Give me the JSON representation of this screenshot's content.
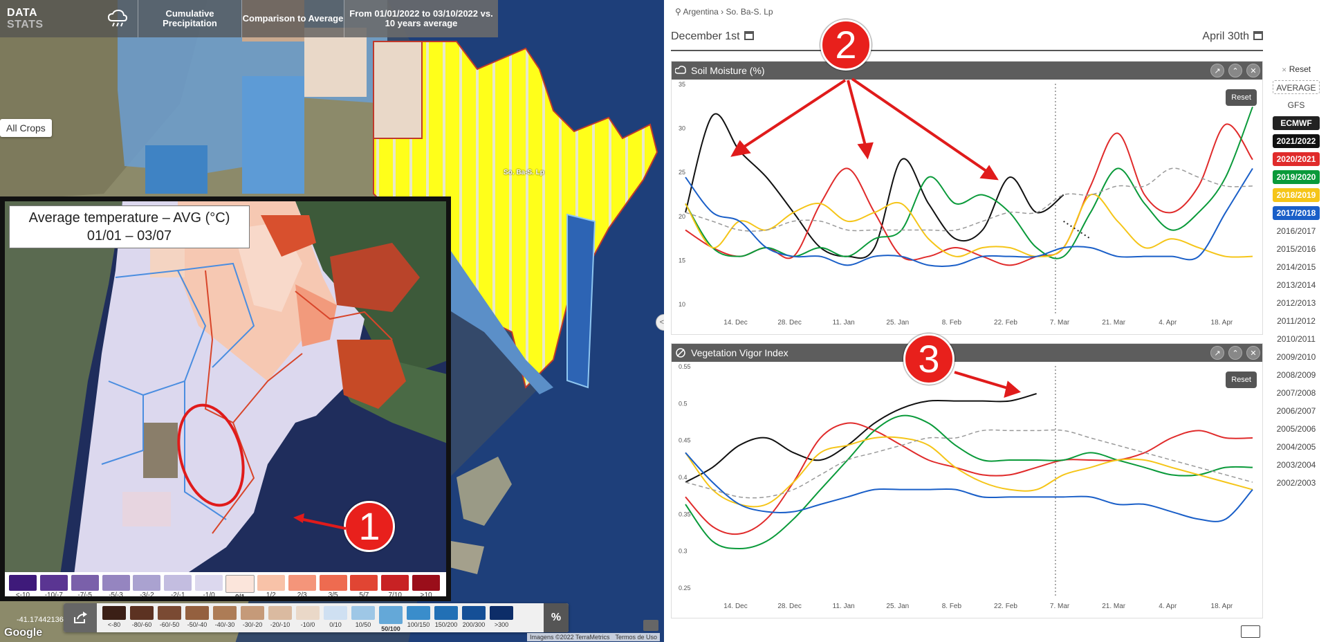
{
  "map": {
    "logo_line1": "DATA",
    "logo_line2": "STATS",
    "weather_icon": "cloud-rain-icon",
    "seg1": "Cumulative Precipitation",
    "seg2": "Comparison to Average",
    "seg3": "From 01/01/2022 to 03/10/2022 vs. 10 years average",
    "all_crops": "All Crops",
    "region_label": "So. Ba-S. Lp",
    "inset_title_line1": "Average temperature – AVG (°C)",
    "inset_title_line2": "01/01 – 03/07",
    "temp_legend": [
      {
        "label": "<-10",
        "color": "#3e1a7a"
      },
      {
        "label": "-10/-7",
        "color": "#5a3592"
      },
      {
        "label": "-7/-5",
        "color": "#7a60aa"
      },
      {
        "label": "-5/-3",
        "color": "#9585c0"
      },
      {
        "label": "-3/-2",
        "color": "#aaa2d0"
      },
      {
        "label": "-2/-1",
        "color": "#c3bde0"
      },
      {
        "label": "-1/0",
        "color": "#dcd8ee"
      },
      {
        "label": "0/1",
        "color": "#fbe5db",
        "selected": true
      },
      {
        "label": "1/2",
        "color": "#f8c2a8"
      },
      {
        "label": "2/3",
        "color": "#f4957a"
      },
      {
        "label": "3/5",
        "color": "#ee6b50"
      },
      {
        "label": "5/7",
        "color": "#e14533"
      },
      {
        "label": "7/10",
        "color": "#c82224"
      },
      {
        "label": ">10",
        "color": "#9a0e1a"
      }
    ],
    "precip_legend": [
      {
        "label": "<-80",
        "color": "#3b1f16"
      },
      {
        "label": "-80/-60",
        "color": "#5c3222"
      },
      {
        "label": "-60/-50",
        "color": "#7a4a33"
      },
      {
        "label": "-50/-40",
        "color": "#94603f"
      },
      {
        "label": "-40/-30",
        "color": "#ad7c56"
      },
      {
        "label": "-30/-20",
        "color": "#c59a79"
      },
      {
        "label": "-20/-10",
        "color": "#dabaa0"
      },
      {
        "label": "-10/0",
        "color": "#ead8c8"
      },
      {
        "label": "0/10",
        "color": "#cfe0f2"
      },
      {
        "label": "10/50",
        "color": "#9ec7e6"
      },
      {
        "label": "50/100",
        "color": "#64a8d8",
        "selected": true
      },
      {
        "label": "100/150",
        "color": "#3a8dcb"
      },
      {
        "label": "150/200",
        "color": "#2270b5"
      },
      {
        "label": "200/300",
        "color": "#154f96"
      },
      {
        ">300": "",
        "label": ">300",
        "color": "#0d2d68"
      }
    ],
    "pct_label": "%",
    "coords": "-41.17442136",
    "google": "Google",
    "attribution": "Imagens ©2022 TerraMetrics",
    "terms": "Termos de Uso"
  },
  "annotations": {
    "c1": "1",
    "c2": "2",
    "c3": "3"
  },
  "panel": {
    "breadcrumb": "Argentina › So. Ba-S. Lp",
    "date_start": "December 1st",
    "date_end": "April 30th",
    "reset_label": "Reset",
    "years": [
      {
        "label": "AVERAGE",
        "kind": "avg"
      },
      {
        "label": "GFS"
      },
      {
        "label": "ECMWF",
        "color": "#222222",
        "active": true
      },
      {
        "label": "2021/2022",
        "color": "#111111",
        "active": true
      },
      {
        "label": "2020/2021",
        "color": "#e02b2b",
        "active": true
      },
      {
        "label": "2019/2020",
        "color": "#0a9a3a",
        "active": true
      },
      {
        "label": "2018/2019",
        "color": "#f5c518",
        "active": true
      },
      {
        "label": "2017/2018",
        "color": "#1a5fc8",
        "active": true
      },
      {
        "label": "2016/2017"
      },
      {
        "label": "2015/2016"
      },
      {
        "label": "2014/2015"
      },
      {
        "label": "2013/2014"
      },
      {
        "label": "2012/2013"
      },
      {
        "label": "2011/2012"
      },
      {
        "label": "2010/2011"
      },
      {
        "label": "2009/2010"
      },
      {
        "label": "2008/2009"
      },
      {
        "label": "2007/2008"
      },
      {
        "label": "2006/2007"
      },
      {
        "label": "2005/2006"
      },
      {
        "label": "2004/2005"
      },
      {
        "label": "2003/2004"
      },
      {
        "label": "2002/2003"
      }
    ]
  },
  "chart_data": [
    {
      "type": "line",
      "title": "Soil Moisture (%)",
      "x": [
        "1 Dec",
        "8 Dec",
        "15 Dec",
        "22 Dec",
        "29 Dec",
        "5 Jan",
        "12 Jan",
        "19 Jan",
        "26 Jan",
        "2 Feb",
        "9 Feb",
        "16 Feb",
        "23 Feb",
        "2 Mar",
        "9 Mar",
        "16 Mar",
        "23 Mar",
        "30 Mar",
        "6 Apr",
        "13 Apr",
        "20 Apr",
        "27 Apr"
      ],
      "x_tick_labels": [
        "14. Dec",
        "28. Dec",
        "11. Jan",
        "25. Jan",
        "8. Feb",
        "22. Feb",
        "7. Mar",
        "21. Mar",
        "4. Apr",
        "18. Apr"
      ],
      "ylim": [
        10,
        35
      ],
      "y_ticks": [
        10,
        15,
        20,
        25,
        30,
        35
      ],
      "today_marker": "9 Mar",
      "series": [
        {
          "name": "2021/2022",
          "color": "#111111",
          "values": [
            21,
            32,
            28,
            25,
            21,
            17,
            16,
            17,
            27,
            22,
            18,
            19,
            25,
            21,
            23,
            null,
            null,
            null,
            null,
            null,
            null,
            null
          ]
        },
        {
          "name": "2020/2021",
          "color": "#e02b2b",
          "values": [
            19,
            17,
            16,
            17,
            16,
            22,
            26,
            21,
            16,
            16,
            17,
            16,
            15,
            16,
            17,
            24,
            30,
            23,
            21,
            24,
            31,
            27
          ]
        },
        {
          "name": "2019/2020",
          "color": "#0a9a3a",
          "values": [
            22,
            17,
            16,
            17,
            16,
            17,
            16,
            18,
            19,
            25,
            22,
            23,
            21,
            17,
            16,
            21,
            26,
            22,
            19,
            21,
            25,
            33
          ]
        },
        {
          "name": "2018/2019",
          "color": "#f5c518",
          "values": [
            22,
            17,
            20,
            19,
            21,
            22,
            20,
            21,
            22,
            18,
            16,
            17,
            17,
            16,
            17,
            23,
            20,
            17,
            18,
            17,
            16,
            16
          ]
        },
        {
          "name": "2017/2018",
          "color": "#1a5fc8",
          "values": [
            25,
            21,
            20,
            17,
            16,
            16,
            15,
            16,
            16,
            15,
            15,
            16,
            16,
            16,
            17,
            17,
            16,
            16,
            16,
            16,
            21,
            26
          ]
        },
        {
          "name": "AVERAGE",
          "color": "#999999",
          "dashed": true,
          "values": [
            21,
            20,
            19,
            19,
            20,
            20,
            19,
            19,
            19,
            19,
            19,
            20,
            21,
            21,
            23,
            23,
            24,
            24,
            26,
            25,
            24,
            24
          ]
        },
        {
          "name": "ECMWF",
          "color": "#222222",
          "dotted": true,
          "values": [
            null,
            null,
            null,
            null,
            null,
            null,
            null,
            null,
            null,
            null,
            null,
            null,
            null,
            null,
            20,
            18,
            null,
            null,
            null,
            null,
            null,
            null
          ]
        }
      ]
    },
    {
      "type": "line",
      "title": "Vegetation Vigor Index",
      "x": [
        "1 Dec",
        "8 Dec",
        "15 Dec",
        "22 Dec",
        "29 Dec",
        "5 Jan",
        "12 Jan",
        "19 Jan",
        "26 Jan",
        "2 Feb",
        "9 Feb",
        "16 Feb",
        "23 Feb",
        "2 Mar",
        "9 Mar",
        "16 Mar",
        "23 Mar",
        "30 Mar",
        "6 Apr",
        "13 Apr",
        "20 Apr",
        "27 Apr"
      ],
      "x_tick_labels": [
        "14. Dec",
        "28. Dec",
        "11. Jan",
        "25. Jan",
        "8. Feb",
        "22. Feb",
        "7. Mar",
        "21. Mar",
        "4. Apr",
        "18. Apr"
      ],
      "ylim": [
        0.25,
        0.55
      ],
      "y_ticks": [
        0.25,
        0.3,
        0.35,
        0.4,
        0.45,
        0.5,
        0.55
      ],
      "today_marker": "9 Mar",
      "series": [
        {
          "name": "2021/2022",
          "color": "#111111",
          "values": [
            0.4,
            0.42,
            0.45,
            0.46,
            0.44,
            0.43,
            0.45,
            0.48,
            0.5,
            0.51,
            0.51,
            0.51,
            0.51,
            0.52,
            null,
            null,
            null,
            null,
            null,
            null,
            null,
            null
          ]
        },
        {
          "name": "2020/2021",
          "color": "#e02b2b",
          "values": [
            0.38,
            0.34,
            0.33,
            0.35,
            0.4,
            0.46,
            0.48,
            0.47,
            0.45,
            0.43,
            0.42,
            0.41,
            0.41,
            0.42,
            0.43,
            0.43,
            0.43,
            0.44,
            0.46,
            0.47,
            0.46,
            0.46
          ]
        },
        {
          "name": "2019/2020",
          "color": "#0a9a3a",
          "values": [
            0.37,
            0.32,
            0.31,
            0.32,
            0.35,
            0.39,
            0.43,
            0.47,
            0.49,
            0.48,
            0.45,
            0.43,
            0.43,
            0.43,
            0.43,
            0.44,
            0.43,
            0.42,
            0.41,
            0.41,
            0.42,
            0.42
          ]
        },
        {
          "name": "2018/2019",
          "color": "#f5c518",
          "values": [
            0.44,
            0.39,
            0.37,
            0.37,
            0.4,
            0.44,
            0.45,
            0.46,
            0.46,
            0.45,
            0.42,
            0.4,
            0.39,
            0.39,
            0.41,
            0.42,
            0.43,
            0.43,
            0.42,
            0.41,
            0.4,
            0.39
          ]
        },
        {
          "name": "2017/2018",
          "color": "#1a5fc8",
          "values": [
            0.44,
            0.4,
            0.37,
            0.36,
            0.36,
            0.37,
            0.38,
            0.39,
            0.39,
            0.39,
            0.39,
            0.38,
            0.38,
            0.38,
            0.38,
            0.38,
            0.37,
            0.37,
            0.36,
            0.35,
            0.35,
            0.39
          ]
        },
        {
          "name": "AVERAGE",
          "color": "#999999",
          "dashed": true,
          "values": [
            0.4,
            0.39,
            0.38,
            0.38,
            0.39,
            0.41,
            0.43,
            0.44,
            0.45,
            0.46,
            0.46,
            0.47,
            0.47,
            0.47,
            0.47,
            0.46,
            0.45,
            0.44,
            0.43,
            0.42,
            0.41,
            0.4
          ]
        }
      ]
    }
  ]
}
